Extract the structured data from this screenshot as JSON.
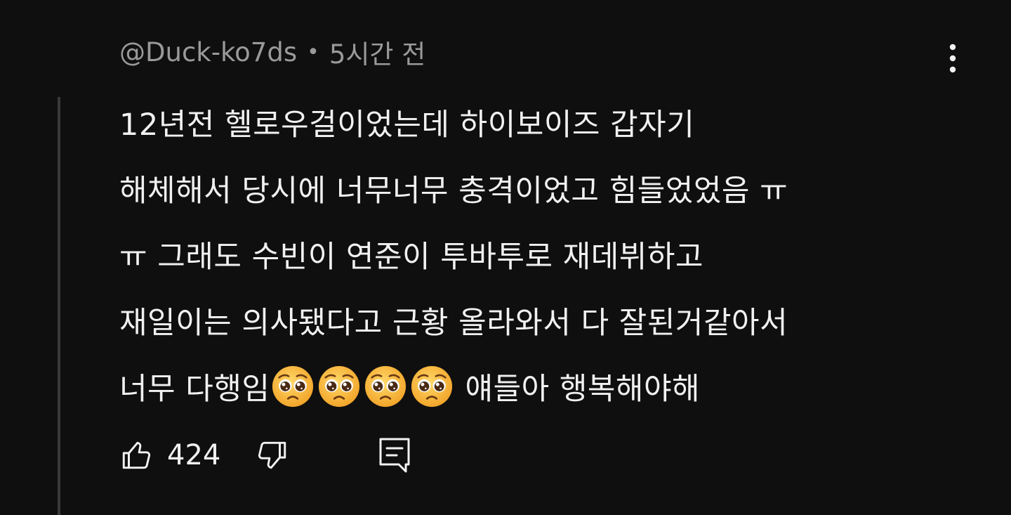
{
  "comment": {
    "author": "@Duck-ko7ds",
    "separator": "•",
    "time": "5시간 전",
    "lines": [
      "12년전 헬로우걸이었는데 하이보이즈 갑자기",
      "해체해서 당시에 너무너무 충격이었고 힘들었었음 ㅠ",
      "ㅠ 그래도 수빈이 연준이 투바투로 재데뷔하고",
      "재일이는 의사됐다고 근황 올라와서 다 잘된거같아서",
      "너무 다행임",
      "얘들아 행복해야해"
    ],
    "emojis": [
      "🥺",
      "🥺",
      "🥺",
      "🥺"
    ],
    "like_count": "424"
  },
  "icons": {
    "menu": "more-vertical-icon",
    "like": "thumbs-up-icon",
    "dislike": "thumbs-down-icon",
    "reply": "comment-reply-icon",
    "emoji": "pleading-face-emoji"
  },
  "colors": {
    "background": "#0f0f0f",
    "text": "#f1f1f1",
    "meta": "#9a9a9a",
    "emoji": "#f7c23a"
  }
}
